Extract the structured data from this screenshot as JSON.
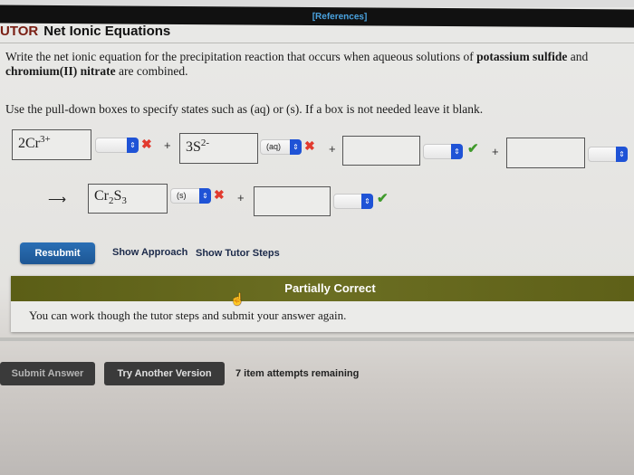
{
  "header": {
    "references_label": "[References]",
    "tutor_label": "UTOR",
    "title": "Net Ionic Equations"
  },
  "question": {
    "text_1": "Write the net ionic equation for the precipitation reaction that occurs when aqueous solutions of ",
    "reagent_1": "potassium sulfide",
    "text_2": " and ",
    "reagent_2": "chromium(II) nitrate",
    "text_3": " are combined.",
    "instructions": "Use the pull-down boxes to specify states such as (aq) or (s). If a box is not needed leave it blank."
  },
  "equation": {
    "plus": "+",
    "arrow": "⟶",
    "reactants": [
      {
        "coef": "2",
        "formula": "Cr",
        "charge": "3+",
        "state": "",
        "status": "incorrect"
      },
      {
        "coef": "3",
        "formula": "S",
        "charge": "2-",
        "state": "(aq)",
        "status": "incorrect"
      },
      {
        "coef": "",
        "formula": "",
        "charge": "",
        "state": "",
        "status": "correct"
      },
      {
        "coef": "",
        "formula": "",
        "charge": "",
        "state": "",
        "status": "unknown"
      }
    ],
    "products": [
      {
        "el1": "Cr",
        "sub1": "2",
        "el2": "S",
        "sub2": "3",
        "state": "(s)",
        "status": "incorrect"
      },
      {
        "formula": "",
        "state": "",
        "status": "correct"
      }
    ],
    "icons": {
      "incorrect": "✖",
      "correct": "✔",
      "select_arrow": "⇕"
    }
  },
  "actions": {
    "resubmit": "Resubmit",
    "show_approach": "Show Approach",
    "show_tutor_steps": "Show Tutor Steps"
  },
  "feedback": {
    "status": "Partially Correct",
    "message": "You can work though the tutor steps and submit your answer again.",
    "status_color": "#63661c"
  },
  "footer": {
    "submit_answer": "Submit Answer",
    "try_another": "Try Another Version",
    "attempts": "7 item attempts remaining"
  }
}
